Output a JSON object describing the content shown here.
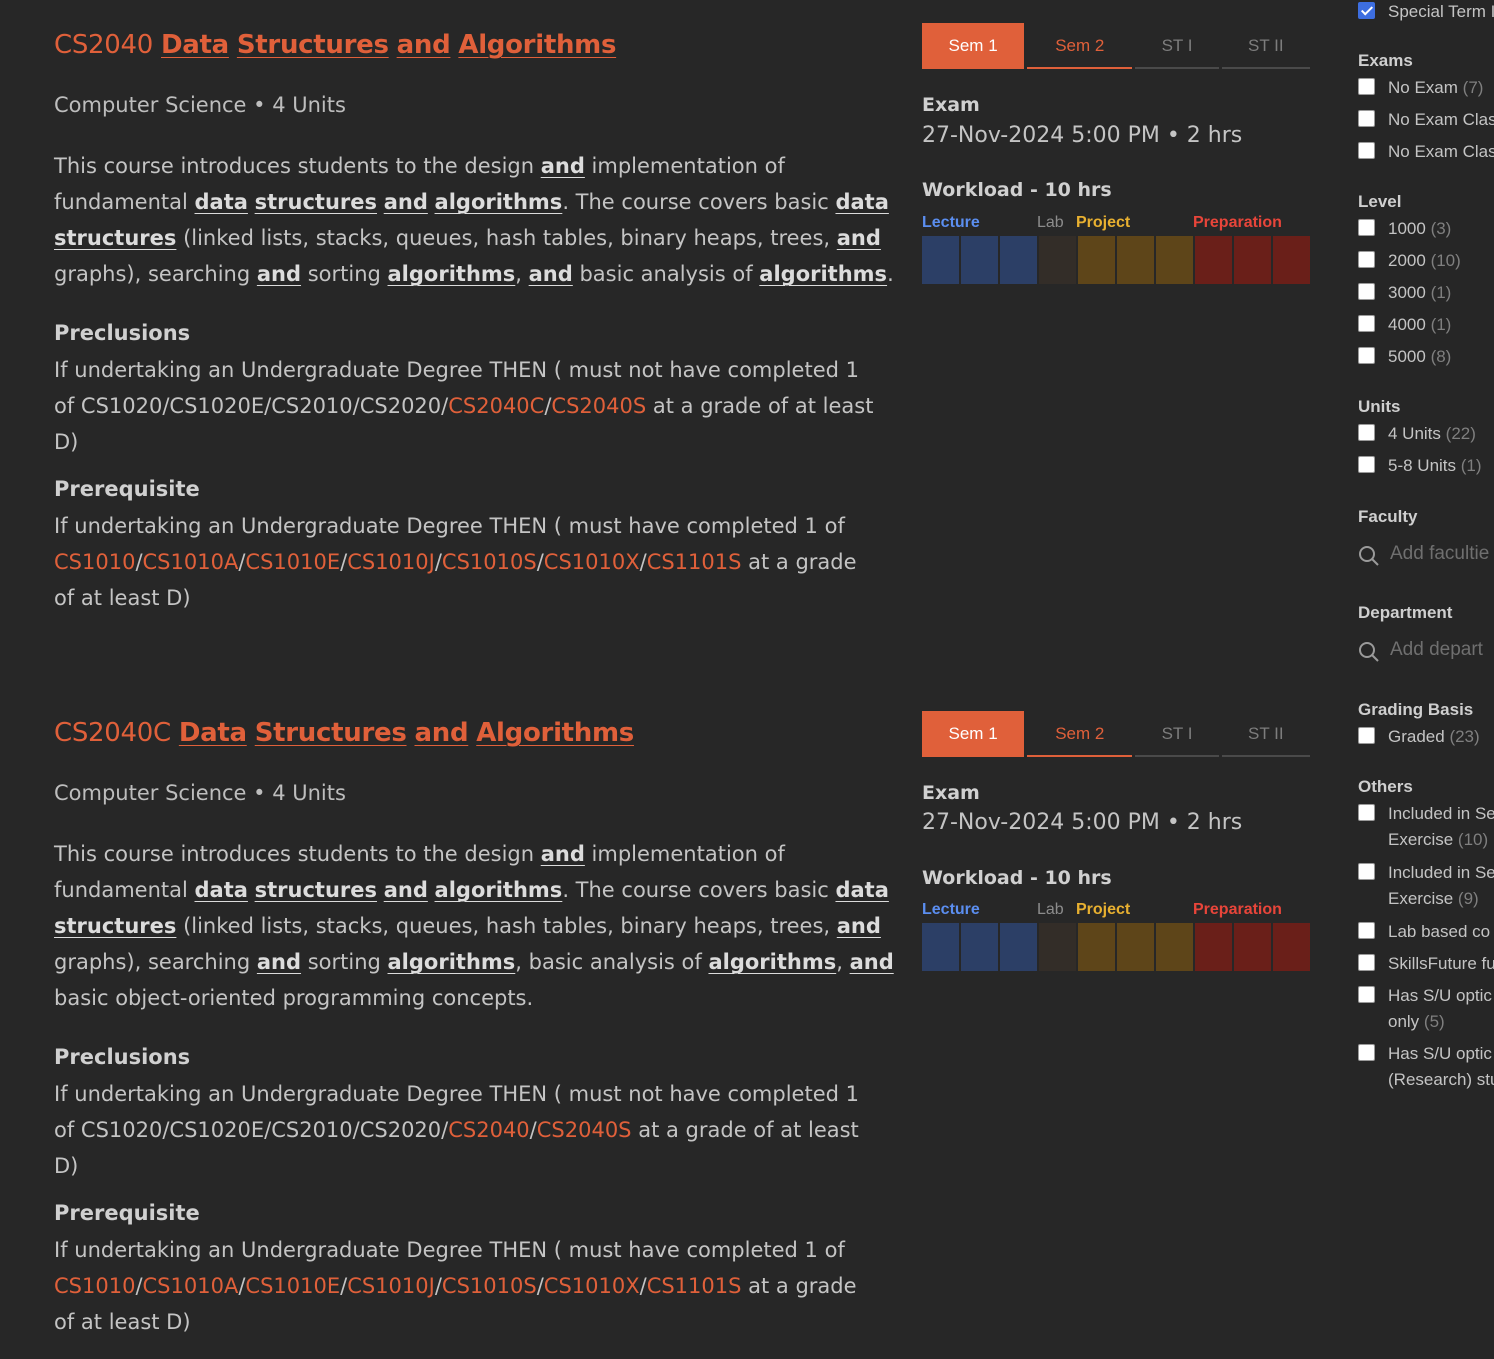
{
  "modules": [
    {
      "code": "CS2040",
      "title_words": [
        "Data",
        "Structures",
        "and",
        "Algorithms"
      ],
      "subtitle": "Computer Science • 4 Units",
      "description_lines": [
        [
          {
            "t": "This course introduces students to the design "
          },
          {
            "t": "and",
            "b": 1
          },
          {
            "t": " implementation of"
          }
        ],
        [
          {
            "t": "fundamental "
          },
          {
            "t": "data",
            "b": 1
          },
          {
            "t": " "
          },
          {
            "t": "structures",
            "b": 1
          },
          {
            "t": " "
          },
          {
            "t": "and",
            "b": 1
          },
          {
            "t": " "
          },
          {
            "t": "algorithms",
            "b": 1
          },
          {
            "t": ". The course covers basic "
          },
          {
            "t": "data",
            "b": 1
          }
        ],
        [
          {
            "t": "structures",
            "b": 1
          },
          {
            "t": " (linked lists, stacks, queues, hash tables, binary heaps, trees, "
          },
          {
            "t": "and",
            "b": 1
          }
        ],
        [
          {
            "t": "graphs), searching "
          },
          {
            "t": "and",
            "b": 1
          },
          {
            "t": " sorting "
          },
          {
            "t": "algorithms",
            "b": 1
          },
          {
            "t": ", "
          },
          {
            "t": "and",
            "b": 1
          },
          {
            "t": " basic analysis of "
          },
          {
            "t": "algorithms",
            "b": 1
          },
          {
            "t": "."
          }
        ]
      ],
      "preclusions_title": "Preclusions",
      "preclusions_lines": [
        [
          {
            "t": "If undertaking an Undergraduate Degree THEN ( must not have completed 1"
          }
        ],
        [
          {
            "t": "of CS1020/CS1020E/CS2010/CS2020/"
          },
          {
            "t": "CS2040C",
            "l": 1
          },
          {
            "t": "/"
          },
          {
            "t": "CS2040S",
            "l": 1
          },
          {
            "t": " at a grade of at least"
          }
        ],
        [
          {
            "t": "D)"
          }
        ]
      ],
      "prerequisite_title": "Prerequisite",
      "prerequisite_lines": [
        [
          {
            "t": "If undertaking an Undergraduate Degree THEN ( must have completed 1 of"
          }
        ],
        [
          {
            "t": "CS1010",
            "l": 1
          },
          {
            "t": "/"
          },
          {
            "t": "CS1010A",
            "l": 1
          },
          {
            "t": "/"
          },
          {
            "t": "CS1010E",
            "l": 1
          },
          {
            "t": "/"
          },
          {
            "t": "CS1010J",
            "l": 1
          },
          {
            "t": "/"
          },
          {
            "t": "CS1010S",
            "l": 1
          },
          {
            "t": "/"
          },
          {
            "t": "CS1010X",
            "l": 1
          },
          {
            "t": "/"
          },
          {
            "t": "CS1101S",
            "l": 1
          },
          {
            "t": " at a grade"
          }
        ],
        [
          {
            "t": "of at least D)"
          }
        ]
      ],
      "tabs": [
        "Sem 1",
        "Sem 2",
        "ST I",
        "ST II"
      ],
      "exam_label": "Exam",
      "exam_value": "27-Nov-2024 5:00 PM • 2 hrs",
      "workload_label": "Workload - 10 hrs",
      "workload": {
        "lecture": 3,
        "tutorial": 0,
        "lab": 1,
        "project": 3,
        "preparation": 3
      },
      "workload_legend": {
        "lecture": "Lecture",
        "lab": "Lab",
        "project": "Project",
        "preparation": "Preparation"
      }
    },
    {
      "code": "CS2040C",
      "title_words": [
        "Data",
        "Structures",
        "and",
        "Algorithms"
      ],
      "subtitle": "Computer Science • 4 Units",
      "description_lines": [
        [
          {
            "t": "This course introduces students to the design "
          },
          {
            "t": "and",
            "b": 1
          },
          {
            "t": " implementation of"
          }
        ],
        [
          {
            "t": "fundamental "
          },
          {
            "t": "data",
            "b": 1
          },
          {
            "t": " "
          },
          {
            "t": "structures",
            "b": 1
          },
          {
            "t": " "
          },
          {
            "t": "and",
            "b": 1
          },
          {
            "t": " "
          },
          {
            "t": "algorithms",
            "b": 1
          },
          {
            "t": ". The course covers basic "
          },
          {
            "t": "data",
            "b": 1
          }
        ],
        [
          {
            "t": "structures",
            "b": 1
          },
          {
            "t": " (linked lists, stacks, queues, hash tables, binary heaps, trees, "
          },
          {
            "t": "and",
            "b": 1
          }
        ],
        [
          {
            "t": "graphs), searching "
          },
          {
            "t": "and",
            "b": 1
          },
          {
            "t": " sorting "
          },
          {
            "t": "algorithms",
            "b": 1
          },
          {
            "t": ", basic analysis of "
          },
          {
            "t": "algorithms",
            "b": 1
          },
          {
            "t": ", "
          },
          {
            "t": "and",
            "b": 1
          }
        ],
        [
          {
            "t": "basic object-oriented programming concepts."
          }
        ]
      ],
      "preclusions_title": "Preclusions",
      "preclusions_lines": [
        [
          {
            "t": "If undertaking an Undergraduate Degree THEN ( must not have completed 1"
          }
        ],
        [
          {
            "t": "of CS1020/CS1020E/CS2010/CS2020/"
          },
          {
            "t": "CS2040",
            "l": 1
          },
          {
            "t": "/"
          },
          {
            "t": "CS2040S",
            "l": 1
          },
          {
            "t": " at a grade of at least"
          }
        ],
        [
          {
            "t": "D)"
          }
        ]
      ],
      "prerequisite_title": "Prerequisite",
      "prerequisite_lines": [
        [
          {
            "t": "If undertaking an Undergraduate Degree THEN ( must have completed 1 of"
          }
        ],
        [
          {
            "t": "CS1010",
            "l": 1
          },
          {
            "t": "/"
          },
          {
            "t": "CS1010A",
            "l": 1
          },
          {
            "t": "/"
          },
          {
            "t": "CS1010E",
            "l": 1
          },
          {
            "t": "/"
          },
          {
            "t": "CS1010J",
            "l": 1
          },
          {
            "t": "/"
          },
          {
            "t": "CS1010S",
            "l": 1
          },
          {
            "t": "/"
          },
          {
            "t": "CS1010X",
            "l": 1
          },
          {
            "t": "/"
          },
          {
            "t": "CS1101S",
            "l": 1
          },
          {
            "t": " at a grade"
          }
        ],
        [
          {
            "t": "of at least D)"
          }
        ]
      ],
      "tabs": [
        "Sem 1",
        "Sem 2",
        "ST I",
        "ST II"
      ],
      "exam_label": "Exam",
      "exam_value": "27-Nov-2024 5:00 PM • 2 hrs",
      "workload_label": "Workload - 10 hrs",
      "workload": {
        "lecture": 3,
        "tutorial": 0,
        "lab": 1,
        "project": 3,
        "preparation": 3
      },
      "workload_legend": {
        "lecture": "Lecture",
        "lab": "Lab",
        "project": "Project",
        "preparation": "Preparation"
      }
    }
  ],
  "sidebar": {
    "special_term": {
      "label": "Special Term I",
      "checked": true
    },
    "exams": {
      "title": "Exams",
      "options": [
        {
          "label": "No Exam",
          "count": "(7)"
        },
        {
          "label": "No Exam Clas",
          "count": ""
        },
        {
          "label": "No Exam Clas",
          "count": ""
        }
      ]
    },
    "level": {
      "title": "Level",
      "options": [
        {
          "label": "1000",
          "count": "(3)"
        },
        {
          "label": "2000",
          "count": "(10)"
        },
        {
          "label": "3000",
          "count": "(1)"
        },
        {
          "label": "4000",
          "count": "(1)"
        },
        {
          "label": "5000",
          "count": "(8)"
        }
      ]
    },
    "units": {
      "title": "Units",
      "options": [
        {
          "label": "4 Units",
          "count": "(22)"
        },
        {
          "label": "5-8 Units",
          "count": "(1)"
        }
      ]
    },
    "faculty": {
      "title": "Faculty",
      "placeholder": "Add facultie"
    },
    "department": {
      "title": "Department",
      "placeholder": "Add depart"
    },
    "grading": {
      "title": "Grading Basis",
      "options": [
        {
          "label": "Graded",
          "count": "(23)"
        }
      ]
    },
    "others": {
      "title": "Others",
      "options": [
        {
          "label": "Included in Se",
          "line2": "Exercise",
          "count": "(10)"
        },
        {
          "label": "Included in Se",
          "line2": "Exercise",
          "count": "(9)"
        },
        {
          "label": "Lab based co",
          "line2": "",
          "count": ""
        },
        {
          "label": "SkillsFuture fu",
          "line2": "",
          "count": ""
        },
        {
          "label": "Has S/U optic",
          "line2": "only",
          "count": "(5)"
        },
        {
          "label": "Has S/U optic",
          "line2": "(Research) stu",
          "count": ""
        }
      ]
    }
  },
  "colors": {
    "accent": "#e0603a",
    "lecture": "#2c3f66",
    "lab": "#332d28",
    "project": "#5e4519",
    "preparation": "#6a1f19",
    "lecture_text": "#5b8ef0",
    "lab_text": "#8c8c8c",
    "project_text": "#e8b030",
    "preparation_text": "#e8453a"
  }
}
